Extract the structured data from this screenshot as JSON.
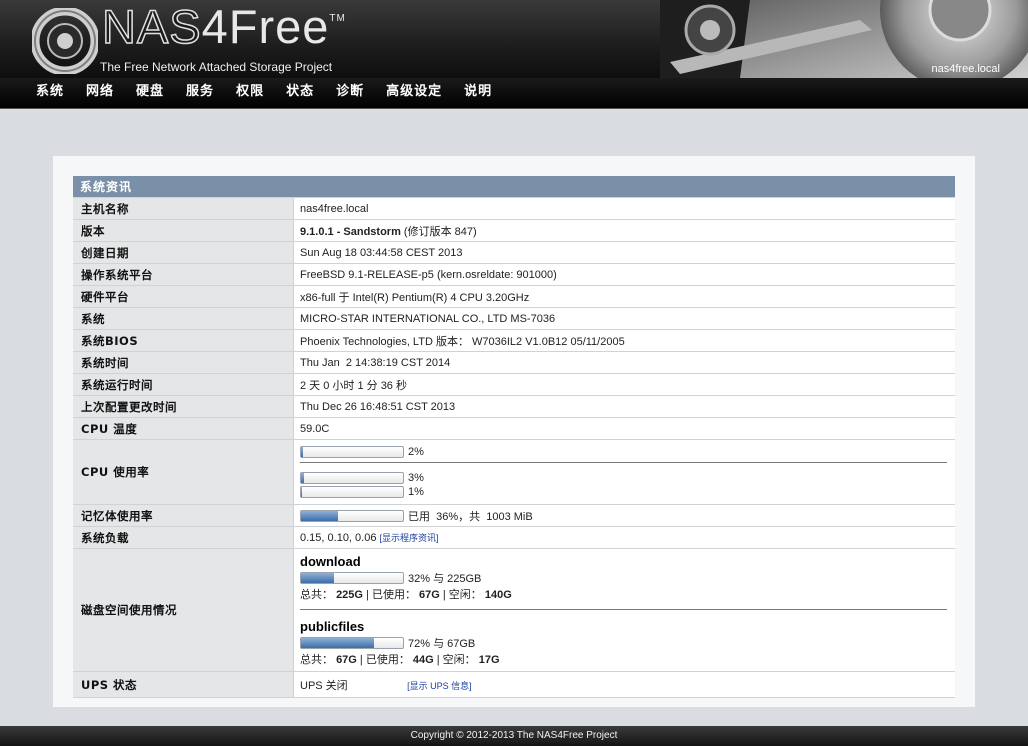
{
  "header": {
    "logo_nas": "NAS",
    "logo_free": "4Free",
    "logo_tm": "TM",
    "tagline": "The Free Network Attached Storage Project",
    "hostname": "nas4free.local"
  },
  "nav": {
    "items": [
      "系统",
      "网络",
      "硬盘",
      "服务",
      "权限",
      "状态",
      "诊断",
      "高级设定",
      "说明"
    ]
  },
  "system_info": {
    "section_title": "系统资讯",
    "hostname": {
      "label": "主机名称",
      "value": "nas4free.local"
    },
    "version": {
      "label": "版本",
      "value_bold": "9.1.0.1 - Sandstorm",
      "value_rest": " (修订版本 847)"
    },
    "build_date": {
      "label": "创建日期",
      "value": "Sun Aug 18 03:44:58 CEST 2013"
    },
    "os_platform": {
      "label": "操作系统平台",
      "value": "FreeBSD 9.1-RELEASE-p5 (kern.osreldate: 901000)"
    },
    "hw_platform": {
      "label": "硬件平台",
      "value": "x86-full 于 Intel(R) Pentium(R) 4 CPU 3.20GHz"
    },
    "system": {
      "label": "系统",
      "value": "MICRO-STAR INTERNATIONAL CO., LTD MS-7036"
    },
    "bios": {
      "label": "系统BIOS",
      "value": "Phoenix Technologies, LTD 版本： W7036IL2 V1.0B12 05/11/2005"
    },
    "sys_time": {
      "label": "系统时间",
      "value": "Thu Jan  2 14:38:19 CST 2014"
    },
    "uptime": {
      "label": "系统运行时间",
      "value": "2 天 0 小时 1 分 36 秒"
    },
    "last_config": {
      "label": "上次配置更改时间",
      "value": "Thu Dec 26 16:48:51 CST 2013"
    },
    "cpu_temp": {
      "label": "CPU 温度",
      "value": "59.0C"
    },
    "cpu_usage": {
      "label": "CPU 使用率",
      "total": {
        "percent": 2,
        "text": "2%"
      },
      "cores": [
        {
          "percent": 3,
          "text": "3%"
        },
        {
          "percent": 1,
          "text": "1%"
        }
      ]
    },
    "memory": {
      "label": "记忆体使用率",
      "percent": 36,
      "text": "已用  36%，共  1003 MiB"
    },
    "load": {
      "label": "系统负载",
      "value": "0.15, 0.10, 0.06",
      "link": "[显示程序资讯]"
    },
    "disk_usage": {
      "label": "磁盘空间使用情况",
      "disks": [
        {
          "name": "download",
          "percent": 32,
          "pct_text": "32% 与 225GB",
          "total_label": "总共：",
          "total": "225G",
          "used_label": "| 已使用：",
          "used": "67G",
          "free_label": "| 空闲：",
          "free": "140G"
        },
        {
          "name": "publicfiles",
          "percent": 72,
          "pct_text": "72% 与 67GB",
          "total_label": "总共：",
          "total": "67G",
          "used_label": "| 已使用：",
          "used": "44G",
          "free_label": "| 空闲：",
          "free": "17G"
        }
      ]
    },
    "ups": {
      "label": "UPS 状态",
      "value": "UPS 关闭",
      "link": "[显示 UPS 信息]"
    }
  },
  "footer": {
    "copyright": "Copyright © 2012-2013 The NAS4Free Project"
  },
  "colors": {
    "section_header": "#7a8fa8",
    "bar_fill": "#3c6ea9",
    "label_bg": "#e5e6e8"
  }
}
